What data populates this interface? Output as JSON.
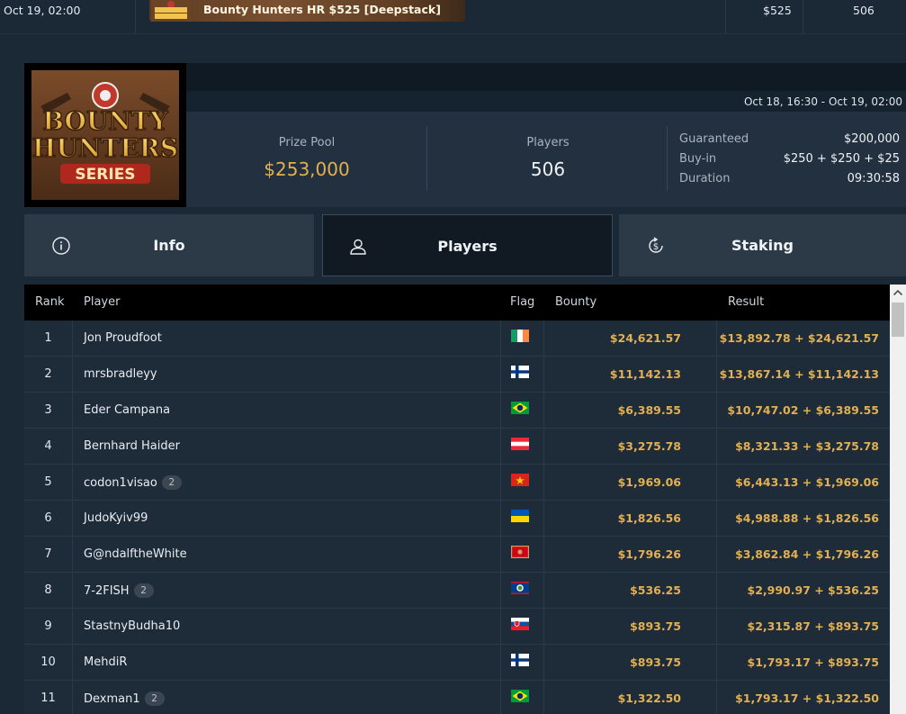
{
  "top_row": {
    "date": "Oct 19, 02:00",
    "banner_title": "Bounty Hunters HR $525 [Deepstack]",
    "buyin": "$525",
    "players": "506"
  },
  "header": {
    "date_range": "Oct 18, 16:30 - Oct 19, 02:00",
    "logo": {
      "line1": "BOUNTY",
      "line2": "HUNTERS",
      "line3": "SERIES"
    },
    "prize_pool_label": "Prize Pool",
    "prize_pool_value": "$253,000",
    "players_label": "Players",
    "players_value": "506",
    "guaranteed_label": "Guaranteed",
    "guaranteed_value": "$200,000",
    "buyin_label": "Buy-in",
    "buyin_value": "$250 + $250 + $25",
    "duration_label": "Duration",
    "duration_value": "09:30:58"
  },
  "tabs": [
    {
      "label": "Info",
      "icon": "info-icon"
    },
    {
      "label": "Players",
      "icon": "user-icon"
    },
    {
      "label": "Staking",
      "icon": "dollar-refresh-icon"
    }
  ],
  "active_tab": "Players",
  "table": {
    "headers": {
      "rank": "Rank",
      "player": "Player",
      "flag": "Flag",
      "bounty": "Bounty",
      "result": "Result"
    },
    "rows": [
      {
        "rank": "1",
        "player": "Jon Proudfoot",
        "badge": "",
        "flag": "ireland",
        "bounty": "$24,621.57",
        "result": "$13,892.78 + $24,621.57"
      },
      {
        "rank": "2",
        "player": "mrsbradleyy",
        "badge": "",
        "flag": "finland",
        "bounty": "$11,142.13",
        "result": "$13,867.14 + $11,142.13"
      },
      {
        "rank": "3",
        "player": "Eder Campana",
        "badge": "",
        "flag": "brazil",
        "bounty": "$6,389.55",
        "result": "$10,747.02 + $6,389.55"
      },
      {
        "rank": "4",
        "player": "Bernhard Haider",
        "badge": "",
        "flag": "austria",
        "bounty": "$3,275.78",
        "result": "$8,321.33 + $3,275.78"
      },
      {
        "rank": "5",
        "player": "codon1visao",
        "badge": "2",
        "flag": "vietnam",
        "bounty": "$1,969.06",
        "result": "$6,443.13 + $1,969.06"
      },
      {
        "rank": "6",
        "player": "JudoKyiv99",
        "badge": "",
        "flag": "ukraine",
        "bounty": "$1,826.56",
        "result": "$4,988.88 + $1,826.56"
      },
      {
        "rank": "7",
        "player": "G@ndalftheWhite",
        "badge": "",
        "flag": "montenegro",
        "bounty": "$1,796.26",
        "result": "$3,862.84 + $1,796.26"
      },
      {
        "rank": "8",
        "player": "7-2FISH",
        "badge": "2",
        "flag": "belize",
        "bounty": "$536.25",
        "result": "$2,990.97 + $536.25"
      },
      {
        "rank": "9",
        "player": "StastnyBudha10",
        "badge": "",
        "flag": "slovakia",
        "bounty": "$893.75",
        "result": "$2,315.87 + $893.75"
      },
      {
        "rank": "10",
        "player": "MehdiR",
        "badge": "",
        "flag": "finland",
        "bounty": "$893.75",
        "result": "$1,793.17 + $893.75"
      },
      {
        "rank": "11",
        "player": "Dexman1",
        "badge": "2",
        "flag": "brazil",
        "bounty": "$1,322.50",
        "result": "$1,793.17 + $1,322.50"
      }
    ]
  },
  "colors": {
    "accent_gold": "#e3b04f",
    "background": "#1b2836",
    "table_header": "#000000"
  }
}
